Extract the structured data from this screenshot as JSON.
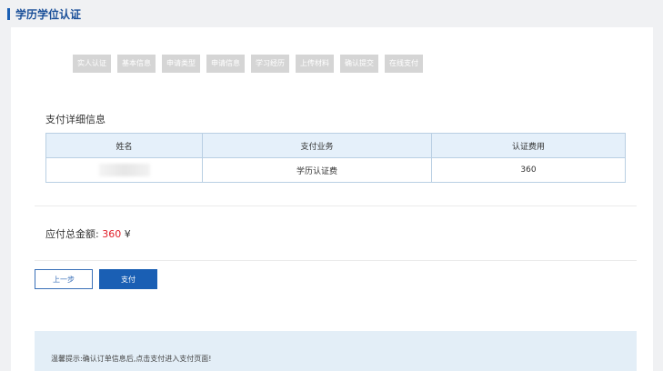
{
  "header": {
    "title": "学历学位认证"
  },
  "steps": [
    "实人认证",
    "基本信息",
    "申请类型",
    "申请信息",
    "学习经历",
    "上传材料",
    "确认提交",
    "在线支付"
  ],
  "payment": {
    "section_title": "支付详细信息",
    "columns": [
      "姓名",
      "支付业务",
      "认证费用"
    ],
    "rows": [
      {
        "name": "",
        "business": "学历认证费",
        "fee": "360"
      }
    ]
  },
  "total": {
    "label": "应付总金额:",
    "amount": "360",
    "currency": "¥"
  },
  "buttons": {
    "prev_label": "上一步",
    "pay_label": "支付"
  },
  "tip": {
    "text": "温馨提示:确认订单信息后,点击支付进入支付页面!"
  },
  "colors": {
    "accent": "#1a5fb4",
    "amount": "#e0202a",
    "step_bg": "#d5d5d5",
    "table_header_bg": "#e5f0fa"
  }
}
